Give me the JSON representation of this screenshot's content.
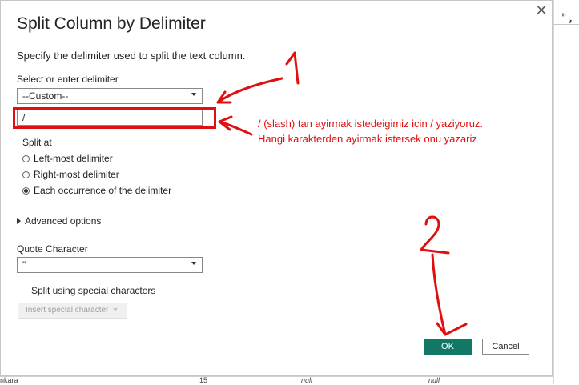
{
  "dialog": {
    "title": "Split Column by Delimiter",
    "description": "Specify the delimiter used to split the text column.",
    "delimiter_label": "Select or enter delimiter",
    "delimiter_value": "--Custom--",
    "custom_delimiter": "/",
    "split_at_label": "Split at",
    "split_options": [
      "Left-most delimiter",
      "Right-most delimiter",
      "Each occurrence of the delimiter"
    ],
    "selected_split_option": "Each occurrence of the delimiter",
    "advanced_label": "Advanced options",
    "quote_label": "Quote Character",
    "quote_value": "\"",
    "special_chars_label": "Split using special characters",
    "insert_special_label": "Insert special character",
    "ok_label": "OK",
    "cancel_label": "Cancel",
    "close_glyph": "✕"
  },
  "background": {
    "quote_fragment": "\",",
    "left_cell": "nkara",
    "num_cell": "15",
    "null_cells": [
      "null",
      "null"
    ]
  },
  "annotations": {
    "line1": "/ (slash) tan ayirmak istedeigimiz icin / yaziyoruz.",
    "line2": "Hangi karakterden ayirmak istersek onu yazariz",
    "mark_1": "1",
    "mark_2": "2",
    "color": "#e01010"
  },
  "colors": {
    "ok_button": "#117865",
    "annotation": "#e01010"
  }
}
